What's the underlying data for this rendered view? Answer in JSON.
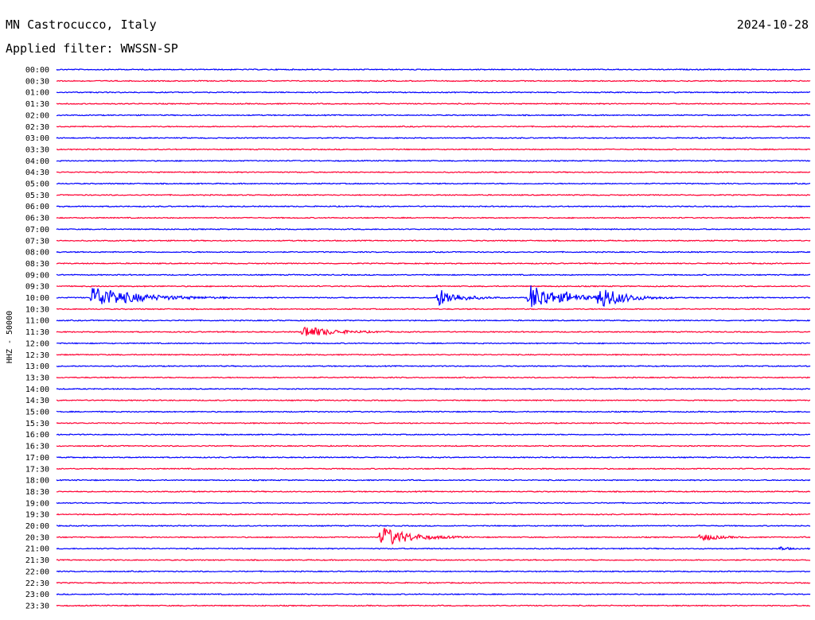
{
  "header": {
    "station": "MN Castrocucco, Italy",
    "date": "2024-10-28",
    "filter": "Applied filter: WWSSN-SP"
  },
  "chart_data": {
    "type": "line",
    "subtype": "helicorder",
    "ylabel": "HHZ - 50000",
    "row_labels": [
      "00:00",
      "00:30",
      "01:00",
      "01:30",
      "02:00",
      "02:30",
      "03:00",
      "03:30",
      "04:00",
      "04:30",
      "05:00",
      "05:30",
      "06:00",
      "06:30",
      "07:00",
      "07:30",
      "08:00",
      "08:30",
      "09:00",
      "09:30",
      "10:00",
      "10:30",
      "11:00",
      "11:30",
      "12:00",
      "12:30",
      "13:00",
      "13:30",
      "14:00",
      "14:30",
      "15:00",
      "15:30",
      "16:00",
      "16:30",
      "17:00",
      "17:30",
      "18:00",
      "18:30",
      "19:00",
      "19:30",
      "20:00",
      "20:30",
      "21:00",
      "21:30",
      "22:00",
      "22:30",
      "23:00",
      "23:30"
    ],
    "row_minutes": 30,
    "series_colors": [
      "#0000ff",
      "#ff0033"
    ],
    "grid": false,
    "events": [
      {
        "row": 20,
        "minute": 1.4,
        "amplitude": 2.9,
        "duration": 5.5
      },
      {
        "row": 23,
        "minute": 9.8,
        "amplitude": 1.6,
        "duration": 3.5
      },
      {
        "row": 20,
        "minute": 15.2,
        "amplitude": 2.3,
        "duration": 2.5
      },
      {
        "row": 20,
        "minute": 18.8,
        "amplitude": 3.6,
        "duration": 3.5
      },
      {
        "row": 20,
        "minute": 20.3,
        "amplitude": 0.75,
        "duration": 1.0
      },
      {
        "row": 20,
        "minute": 21.6,
        "amplitude": 3.0,
        "duration": 3.0
      },
      {
        "row": 41,
        "minute": 12.9,
        "amplitude": 2.8,
        "duration": 3.5
      },
      {
        "row": 41,
        "minute": 25.6,
        "amplitude": 1.1,
        "duration": 2.0
      },
      {
        "row": 42,
        "minute": 28.8,
        "amplitude": 0.5,
        "duration": 1.0
      }
    ]
  }
}
